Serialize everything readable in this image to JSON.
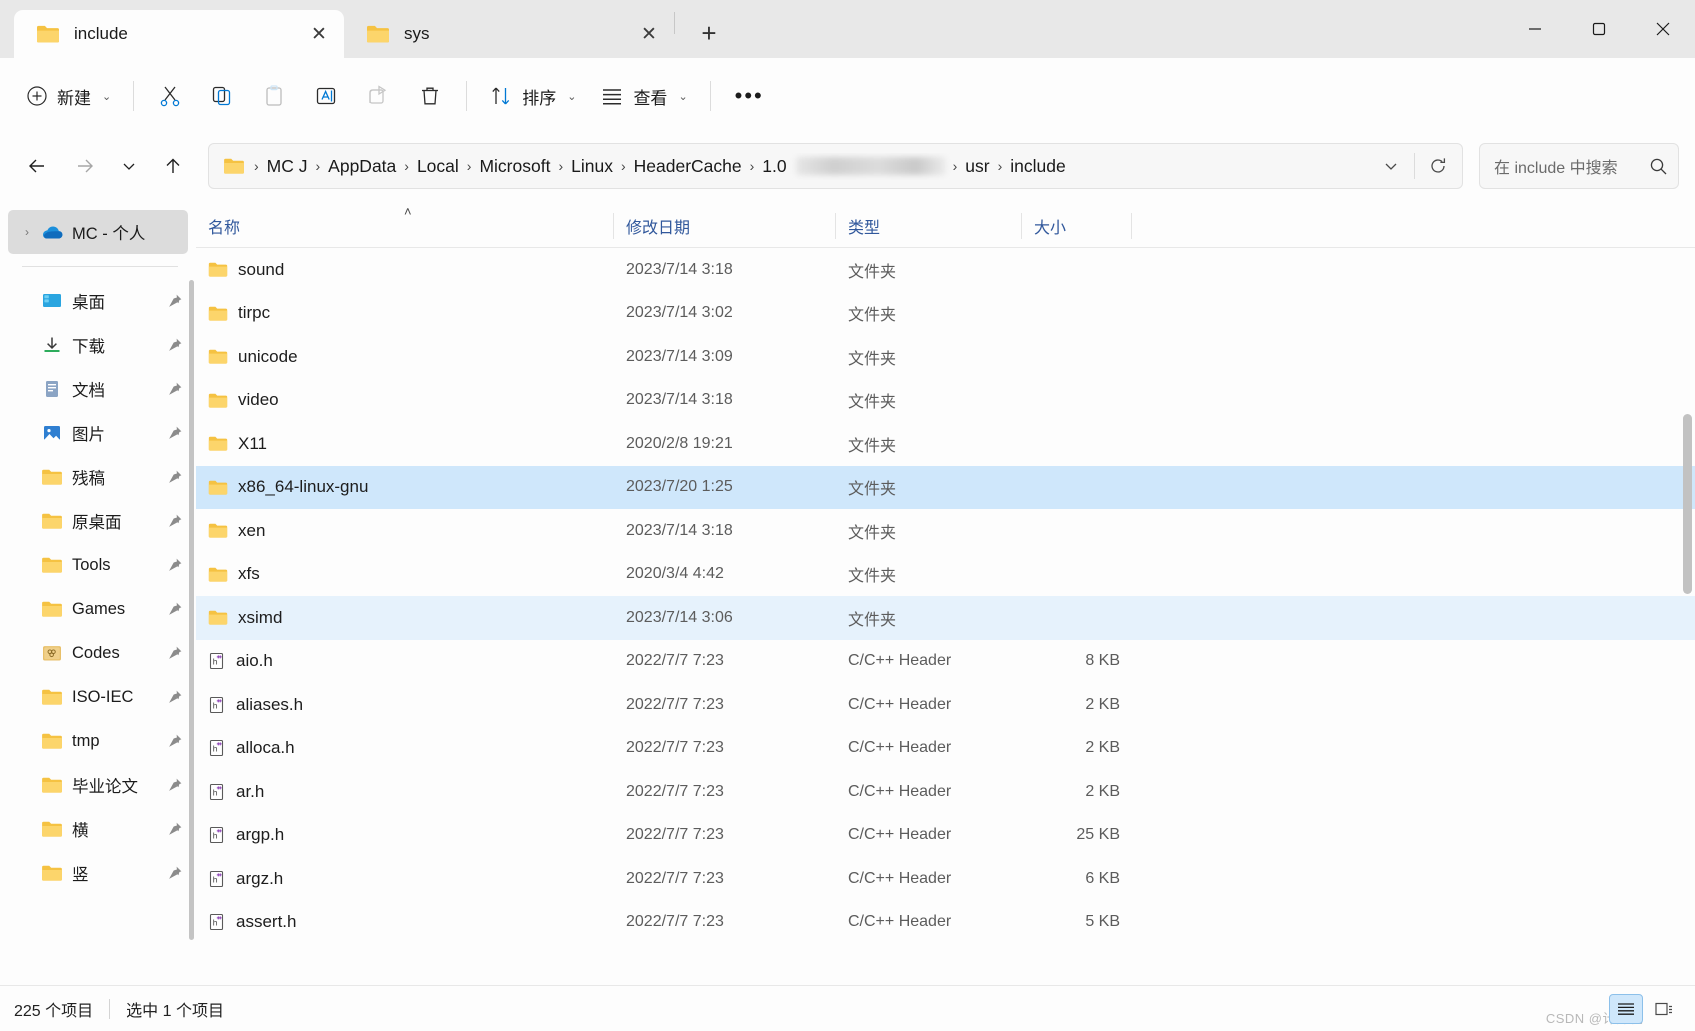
{
  "window": {
    "controls": {
      "minimize": "minimize-icon",
      "maximize": "maximize-icon",
      "close": "close-icon"
    }
  },
  "tabs": [
    {
      "label": "include",
      "active": true,
      "close_label": "✕"
    },
    {
      "label": "sys",
      "active": false,
      "close_label": "✕"
    }
  ],
  "new_tab_label": "+",
  "toolbar": {
    "new_label": "新建",
    "cut_label": "剪切",
    "copy_label": "复制",
    "paste_label": "粘贴",
    "rename_label": "重命名",
    "share_label": "共享",
    "delete_label": "删除",
    "sort_label": "排序",
    "view_label": "查看",
    "more_label": "•••",
    "chevron": "⌄"
  },
  "address": {
    "back": "back-arrow",
    "forward": "forward-arrow",
    "recent": "⌄",
    "up": "up-arrow",
    "crumbs": [
      {
        "text": "MC J",
        "blurred": false
      },
      {
        "text": "AppData",
        "blurred": false
      },
      {
        "text": "Local",
        "blurred": false
      },
      {
        "text": "Microsoft",
        "blurred": false
      },
      {
        "text": "Linux",
        "blurred": false
      },
      {
        "text": "HeaderCache",
        "blurred": false
      },
      {
        "text": "1.0",
        "blurred": false
      },
      {
        "text": "",
        "blurred": true
      },
      {
        "text": "usr",
        "blurred": false
      },
      {
        "text": "include",
        "blurred": false
      }
    ],
    "separator": "›",
    "dropdown": "⌄",
    "refresh": "refresh-icon"
  },
  "search": {
    "placeholder": "在 include 中搜索",
    "icon": "search-icon"
  },
  "sidebar": {
    "cloud": {
      "label": "MC - 个人",
      "expander": "›",
      "selected": true
    },
    "items": [
      {
        "label": "桌面",
        "icon": "desktop",
        "pinned": true
      },
      {
        "label": "下载",
        "icon": "download",
        "pinned": true
      },
      {
        "label": "文档",
        "icon": "document",
        "pinned": true
      },
      {
        "label": "图片",
        "icon": "picture",
        "pinned": true
      },
      {
        "label": "残稿",
        "icon": "folder",
        "pinned": true
      },
      {
        "label": "原桌面",
        "icon": "folder",
        "pinned": true
      },
      {
        "label": "Tools",
        "icon": "folder",
        "pinned": true
      },
      {
        "label": "Games",
        "icon": "folder",
        "pinned": true
      },
      {
        "label": "Codes",
        "icon": "folder-special",
        "pinned": true
      },
      {
        "label": "ISO-IEC",
        "icon": "folder",
        "pinned": true
      },
      {
        "label": "tmp",
        "icon": "folder",
        "pinned": true
      },
      {
        "label": "毕业论文",
        "icon": "folder",
        "pinned": true
      },
      {
        "label": "横",
        "icon": "folder",
        "pinned": true
      },
      {
        "label": "竖",
        "icon": "folder",
        "pinned": true
      }
    ]
  },
  "columns": {
    "name": "名称",
    "date": "修改日期",
    "type": "类型",
    "size": "大小",
    "sort_arrow": "˄"
  },
  "files": [
    {
      "name": "sound",
      "date": "2023/7/14 3:18",
      "type": "文件夹",
      "size": "",
      "icon": "folder",
      "state": ""
    },
    {
      "name": "tirpc",
      "date": "2023/7/14 3:02",
      "type": "文件夹",
      "size": "",
      "icon": "folder",
      "state": ""
    },
    {
      "name": "unicode",
      "date": "2023/7/14 3:09",
      "type": "文件夹",
      "size": "",
      "icon": "folder",
      "state": ""
    },
    {
      "name": "video",
      "date": "2023/7/14 3:18",
      "type": "文件夹",
      "size": "",
      "icon": "folder",
      "state": ""
    },
    {
      "name": "X11",
      "date": "2020/2/8 19:21",
      "type": "文件夹",
      "size": "",
      "icon": "folder",
      "state": ""
    },
    {
      "name": "x86_64-linux-gnu",
      "date": "2023/7/20 1:25",
      "type": "文件夹",
      "size": "",
      "icon": "folder",
      "state": "selected"
    },
    {
      "name": "xen",
      "date": "2023/7/14 3:18",
      "type": "文件夹",
      "size": "",
      "icon": "folder",
      "state": ""
    },
    {
      "name": "xfs",
      "date": "2020/3/4 4:42",
      "type": "文件夹",
      "size": "",
      "icon": "folder",
      "state": ""
    },
    {
      "name": "xsimd",
      "date": "2023/7/14 3:06",
      "type": "文件夹",
      "size": "",
      "icon": "folder",
      "state": "hover"
    },
    {
      "name": "aio.h",
      "date": "2022/7/7 7:23",
      "type": "C/C++ Header",
      "size": "8 KB",
      "icon": "header",
      "state": ""
    },
    {
      "name": "aliases.h",
      "date": "2022/7/7 7:23",
      "type": "C/C++ Header",
      "size": "2 KB",
      "icon": "header",
      "state": ""
    },
    {
      "name": "alloca.h",
      "date": "2022/7/7 7:23",
      "type": "C/C++ Header",
      "size": "2 KB",
      "icon": "header",
      "state": ""
    },
    {
      "name": "ar.h",
      "date": "2022/7/7 7:23",
      "type": "C/C++ Header",
      "size": "2 KB",
      "icon": "header",
      "state": ""
    },
    {
      "name": "argp.h",
      "date": "2022/7/7 7:23",
      "type": "C/C++ Header",
      "size": "25 KB",
      "icon": "header",
      "state": ""
    },
    {
      "name": "argz.h",
      "date": "2022/7/7 7:23",
      "type": "C/C++ Header",
      "size": "6 KB",
      "icon": "header",
      "state": ""
    },
    {
      "name": "assert.h",
      "date": "2022/7/7 7:23",
      "type": "C/C++ Header",
      "size": "5 KB",
      "icon": "header",
      "state": ""
    }
  ],
  "status": {
    "item_count": "225 个项目",
    "selection": "选中 1 个项目",
    "watermark": "CSDN @计算机",
    "details_view": "details-view-icon",
    "thumbnail_view": "thumbnail-view-icon"
  }
}
